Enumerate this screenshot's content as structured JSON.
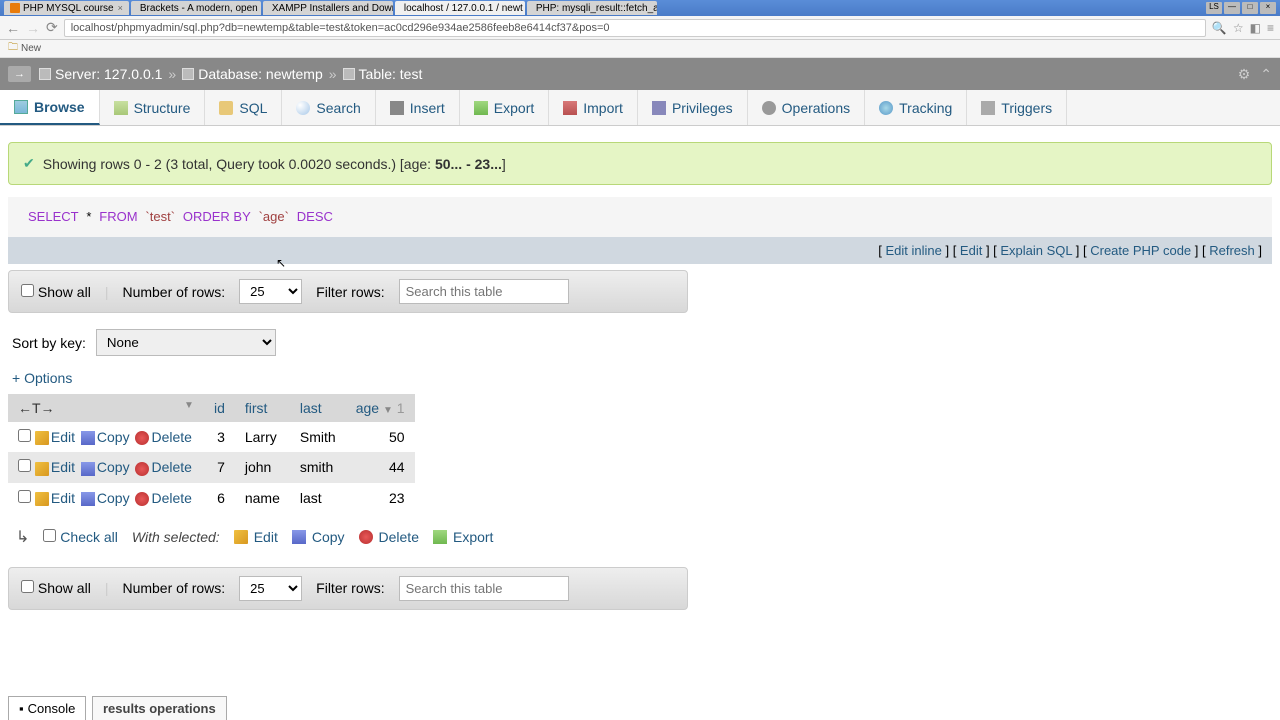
{
  "window": {
    "ls": "LS"
  },
  "tabs": [
    {
      "title": "PHP MYSQL course"
    },
    {
      "title": "Brackets - A modern, open "
    },
    {
      "title": "XAMPP Installers and Down"
    },
    {
      "title": "localhost / 127.0.0.1 / newt",
      "active": true
    },
    {
      "title": "PHP: mysqli_result::fetch_a"
    }
  ],
  "url": "localhost/phpmyadmin/sql.php?db=newtemp&table=test&token=ac0cd296e934ae2586feeb8e6414cf37&pos=0",
  "bookmarks": {
    "new": "New"
  },
  "breadcrumb": {
    "server_label": "Server:",
    "server": "127.0.0.1",
    "db_label": "Database:",
    "db": "newtemp",
    "table_label": "Table:",
    "table": "test"
  },
  "toptabs": {
    "browse": "Browse",
    "structure": "Structure",
    "sql": "SQL",
    "search": "Search",
    "insert": "Insert",
    "export": "Export",
    "import": "Import",
    "privileges": "Privileges",
    "operations": "Operations",
    "tracking": "Tracking",
    "triggers": "Triggers"
  },
  "success": {
    "text": "Showing rows 0 - 2 (3 total, Query took 0.0020 seconds.) [age:",
    "range": "50... - 23...",
    "close": "]"
  },
  "sql": {
    "select": "SELECT",
    "star": "*",
    "from": "FROM",
    "table": "`test`",
    "order": "ORDER BY",
    "col": "`age`",
    "dir": "DESC"
  },
  "sql_links": {
    "edit_inline": "Edit inline",
    "edit": "Edit",
    "explain": "Explain SQL",
    "php": "Create PHP code",
    "refresh": "Refresh"
  },
  "controls": {
    "show_all": "Show all",
    "num_rows_label": "Number of rows:",
    "num_rows": "25",
    "filter_label": "Filter rows:",
    "filter_placeholder": "Search this table"
  },
  "sort": {
    "label": "Sort by key:",
    "value": "None"
  },
  "options_link": "+ Options",
  "columns": {
    "arrows": "←T→",
    "id": "id",
    "first": "first",
    "last": "last",
    "age": "age",
    "one": "1"
  },
  "row_actions": {
    "edit": "Edit",
    "copy": "Copy",
    "delete": "Delete"
  },
  "rows": [
    {
      "id": "3",
      "first": "Larry",
      "last": "Smith",
      "age": "50"
    },
    {
      "id": "7",
      "first": "john",
      "last": "smith",
      "age": "44"
    },
    {
      "id": "6",
      "first": "name",
      "last": "last",
      "age": "23"
    }
  ],
  "checkall": {
    "label": "Check all",
    "with_selected": "With selected:",
    "edit": "Edit",
    "copy": "Copy",
    "delete": "Delete",
    "export": "Export"
  },
  "console": "Console",
  "results_ops": "results operations"
}
